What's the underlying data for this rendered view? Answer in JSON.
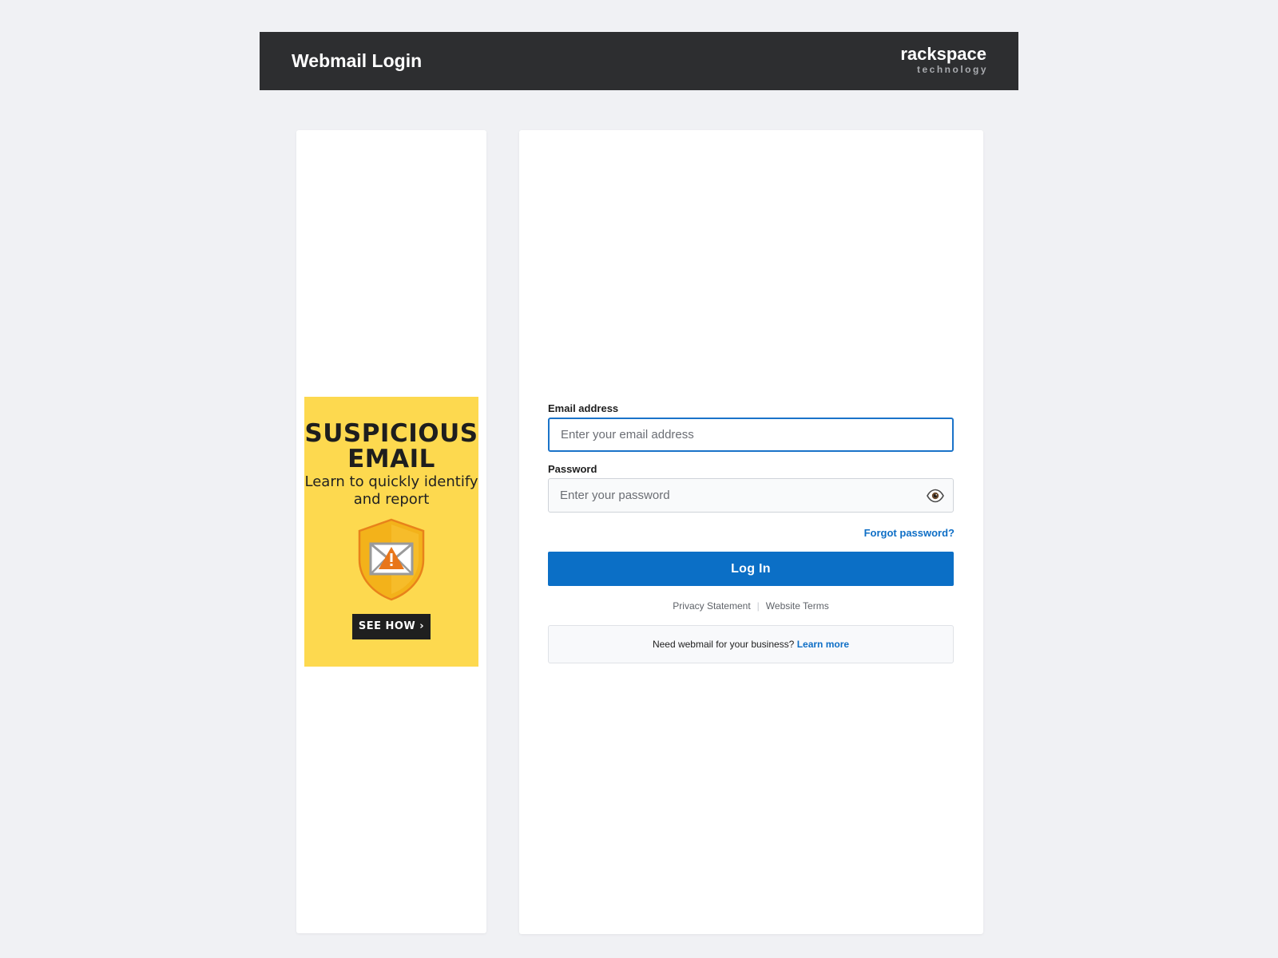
{
  "header": {
    "title": "Webmail Login",
    "brand_name": "rackspace",
    "brand_sub": "technology"
  },
  "ad": {
    "headline": "SUSPICIOUS EMAIL",
    "subline": "Learn to quickly identify and report",
    "cta": "SEE HOW ›",
    "icon": "shield-email-warning-icon",
    "background_color": "#fdd94f"
  },
  "login": {
    "email_label": "Email address",
    "email_placeholder": "Enter your email address",
    "email_value": "",
    "password_label": "Password",
    "password_placeholder": "Enter your password",
    "password_value": "",
    "show_password_icon": "eye-icon",
    "forgot_label": "Forgot password?",
    "submit_label": "Log In",
    "accent_color": "#0b6fc6"
  },
  "footer": {
    "privacy_label": "Privacy Statement",
    "terms_label": "Website Terms",
    "biz_text": "Need webmail for your business?",
    "biz_link": "Learn more"
  }
}
